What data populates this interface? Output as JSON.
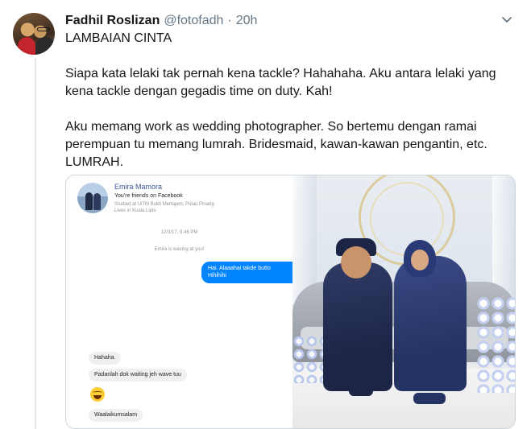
{
  "tweet": {
    "author_name": "Fadhil Roslizan",
    "handle": "@fotofadh",
    "separator": "·",
    "time": "20h",
    "lines": [
      "LAMBAIAN CINTA",
      "Siapa kata lelaki tak pernah kena tackle? Hahahaha. Aku antara lelaki yang",
      "kena tackle dengan gegadis time on duty. Kah!",
      "Aku memang work as wedding photographer. So bertemu dengan ramai",
      "perempuan tu memang lumrah. Bridesmaid, kawan-kawan pengantin, etc.",
      "LUMRAH."
    ]
  },
  "media": {
    "messenger": {
      "contact_name": "Emira Mamora",
      "friends_note": "You're friends on Facebook",
      "studied": "Studied at UiTM Bukit Mertajam, Pulau Pinang",
      "lives": "Lives in Kuala Lipis",
      "timestamp": "12/3/17, 9:46 PM",
      "wave_note": "Emira is waving at you!",
      "outgoing": [
        "Hai. Alaaahai takde butto",
        "Hihihihi"
      ],
      "incoming": [
        "Hahaha.",
        "Padanlah dok waiting jeh wave tuu",
        "Waalaikumsalam"
      ],
      "emoji": "laughing-tears-emoji"
    },
    "photo": {
      "subject": "wedding-couple-photo"
    }
  },
  "colors": {
    "name": "#14171a",
    "meta": "#657786",
    "messenger_blue": "#0084ff",
    "link": "#3b5998"
  }
}
